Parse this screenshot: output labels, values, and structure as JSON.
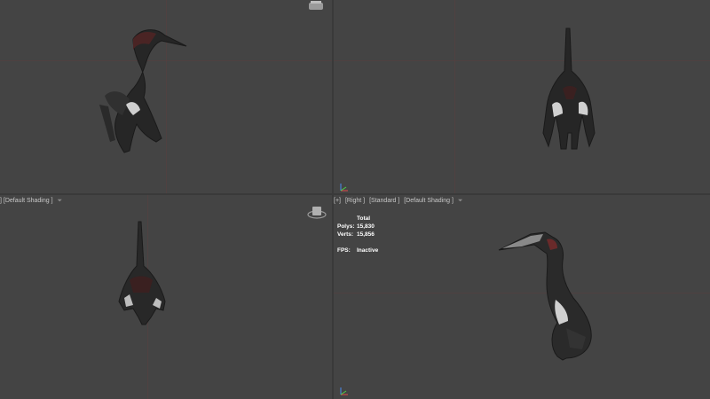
{
  "viewports": {
    "top_left": {
      "shading_label": "] [Default Shading ]"
    },
    "bottom_right": {
      "plus_label": "[+]",
      "view_label": "[Right ]",
      "mode_label": "[Standard ]",
      "shading_label": "[Default Shading ]"
    }
  },
  "stats": {
    "header": "Total",
    "polys_label": "Polys:",
    "polys_value": "15,830",
    "verts_label": "Verts:",
    "verts_value": "15,856",
    "fps_label": "FPS:",
    "fps_value": "Inactive"
  },
  "icons": {
    "filter": "funnel-icon",
    "nav_cube": "viewcube-icon",
    "axis": "xyz-axis-gizmo"
  },
  "colors": {
    "viewport_bg": "#444444",
    "grid_line": "#5a4040",
    "label_text": "#c8c8c8",
    "stats_text": "#ffffff"
  }
}
